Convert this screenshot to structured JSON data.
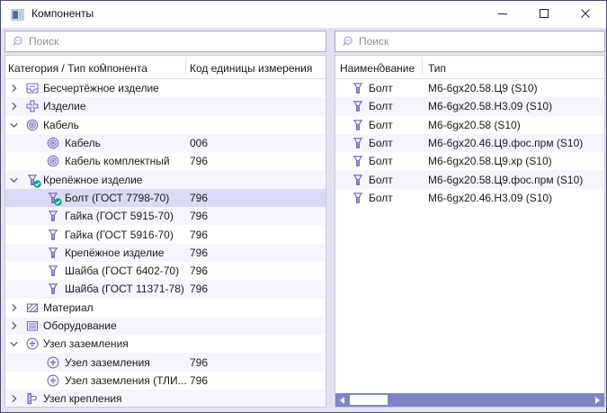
{
  "window": {
    "title": "Компоненты"
  },
  "colors": {
    "icon_purple": "#6e64bd",
    "selection_row": "#dbdaf4",
    "alt_row": "#f6f5fd",
    "scrollbar_track": "#7d84c6",
    "check_badge_green": "#15a48e",
    "body_background": "#e2e2f1"
  },
  "left_panel": {
    "search": {
      "placeholder": "Поиск"
    },
    "table": {
      "columns": [
        "Категория / Тип компонента",
        "Код единицы измерения"
      ],
      "sorted_column": "Категория / Тип компонента",
      "rows": [
        {
          "label": "Бесчертёжное изделие",
          "code": "",
          "level": 0,
          "state": "collapsed",
          "icon": "noprint-product-icon",
          "checked": false,
          "selected": false
        },
        {
          "label": "Изделие",
          "code": "",
          "level": 0,
          "state": "collapsed",
          "icon": "product-icon",
          "checked": false,
          "selected": false
        },
        {
          "label": "Кабель",
          "code": "",
          "level": 0,
          "state": "expanded",
          "icon": "cable-icon",
          "checked": false,
          "selected": false
        },
        {
          "label": "Кабель",
          "code": "006",
          "level": 1,
          "state": "",
          "icon": "cable-icon",
          "checked": false,
          "selected": false
        },
        {
          "label": "Кабель комплектный",
          "code": "796",
          "level": 1,
          "state": "",
          "icon": "cable-icon",
          "checked": false,
          "selected": false
        },
        {
          "label": "Крепёжное изделие",
          "code": "",
          "level": 0,
          "state": "expanded",
          "icon": "bolt-icon",
          "checked": true,
          "selected": false
        },
        {
          "label": "Болт (ГОСТ 7798-70)",
          "code": "796",
          "level": 1,
          "state": "",
          "icon": "bolt-icon",
          "checked": true,
          "selected": true
        },
        {
          "label": "Гайка (ГОСТ 5915-70)",
          "code": "796",
          "level": 1,
          "state": "",
          "icon": "bolt-icon",
          "checked": false,
          "selected": false
        },
        {
          "label": "Гайка (ГОСТ 5916-70)",
          "code": "796",
          "level": 1,
          "state": "",
          "icon": "bolt-icon",
          "checked": false,
          "selected": false
        },
        {
          "label": "Крепёжное изделие",
          "code": "796",
          "level": 1,
          "state": "",
          "icon": "bolt-icon",
          "checked": false,
          "selected": false
        },
        {
          "label": "Шайба (ГОСТ 6402-70)",
          "code": "796",
          "level": 1,
          "state": "",
          "icon": "bolt-icon",
          "checked": false,
          "selected": false
        },
        {
          "label": "Шайба (ГОСТ 11371-78)",
          "code": "796",
          "level": 1,
          "state": "",
          "icon": "bolt-icon",
          "checked": false,
          "selected": false
        },
        {
          "label": "Материал",
          "code": "",
          "level": 0,
          "state": "collapsed",
          "icon": "material-icon",
          "checked": false,
          "selected": false
        },
        {
          "label": "Оборудование",
          "code": "",
          "level": 0,
          "state": "collapsed",
          "icon": "equipment-icon",
          "checked": false,
          "selected": false
        },
        {
          "label": "Узел заземления",
          "code": "",
          "level": 0,
          "state": "expanded",
          "icon": "ground-icon",
          "checked": false,
          "selected": false
        },
        {
          "label": "Узел заземления",
          "code": "796",
          "level": 1,
          "state": "",
          "icon": "ground-icon",
          "checked": false,
          "selected": false
        },
        {
          "label": "Узел заземления (ТЛИ...",
          "code": "796",
          "level": 1,
          "state": "",
          "icon": "ground-icon",
          "checked": false,
          "selected": false
        },
        {
          "label": "Узел крепления",
          "code": "",
          "level": 0,
          "state": "collapsed",
          "icon": "mount-icon",
          "checked": false,
          "selected": false
        }
      ]
    }
  },
  "right_panel": {
    "search": {
      "placeholder": "Поиск"
    },
    "table": {
      "columns": [
        "Наименование",
        "Тип"
      ],
      "sorted_column": "Наименование",
      "rows": [
        {
          "name": "Болт",
          "type": "М6-6gx20.58.Ц9 (S10)",
          "icon": "bolt-icon"
        },
        {
          "name": "Болт",
          "type": "М6-6gx20.58.Н3.09 (S10)",
          "icon": "bolt-icon"
        },
        {
          "name": "Болт",
          "type": "М6-6gx20.58 (S10)",
          "icon": "bolt-icon"
        },
        {
          "name": "Болт",
          "type": "М6-6gx20.46.Ц9.фос.прм (S10)",
          "icon": "bolt-icon"
        },
        {
          "name": "Болт",
          "type": "М6-6gx20.58.Ц9.хр (S10)",
          "icon": "bolt-icon"
        },
        {
          "name": "Болт",
          "type": "М6-6gx20.58.Ц9.фос.прм (S10)",
          "icon": "bolt-icon"
        },
        {
          "name": "Болт",
          "type": "М6-6gx20.46.Н3.09 (S10)",
          "icon": "bolt-icon"
        }
      ]
    }
  }
}
